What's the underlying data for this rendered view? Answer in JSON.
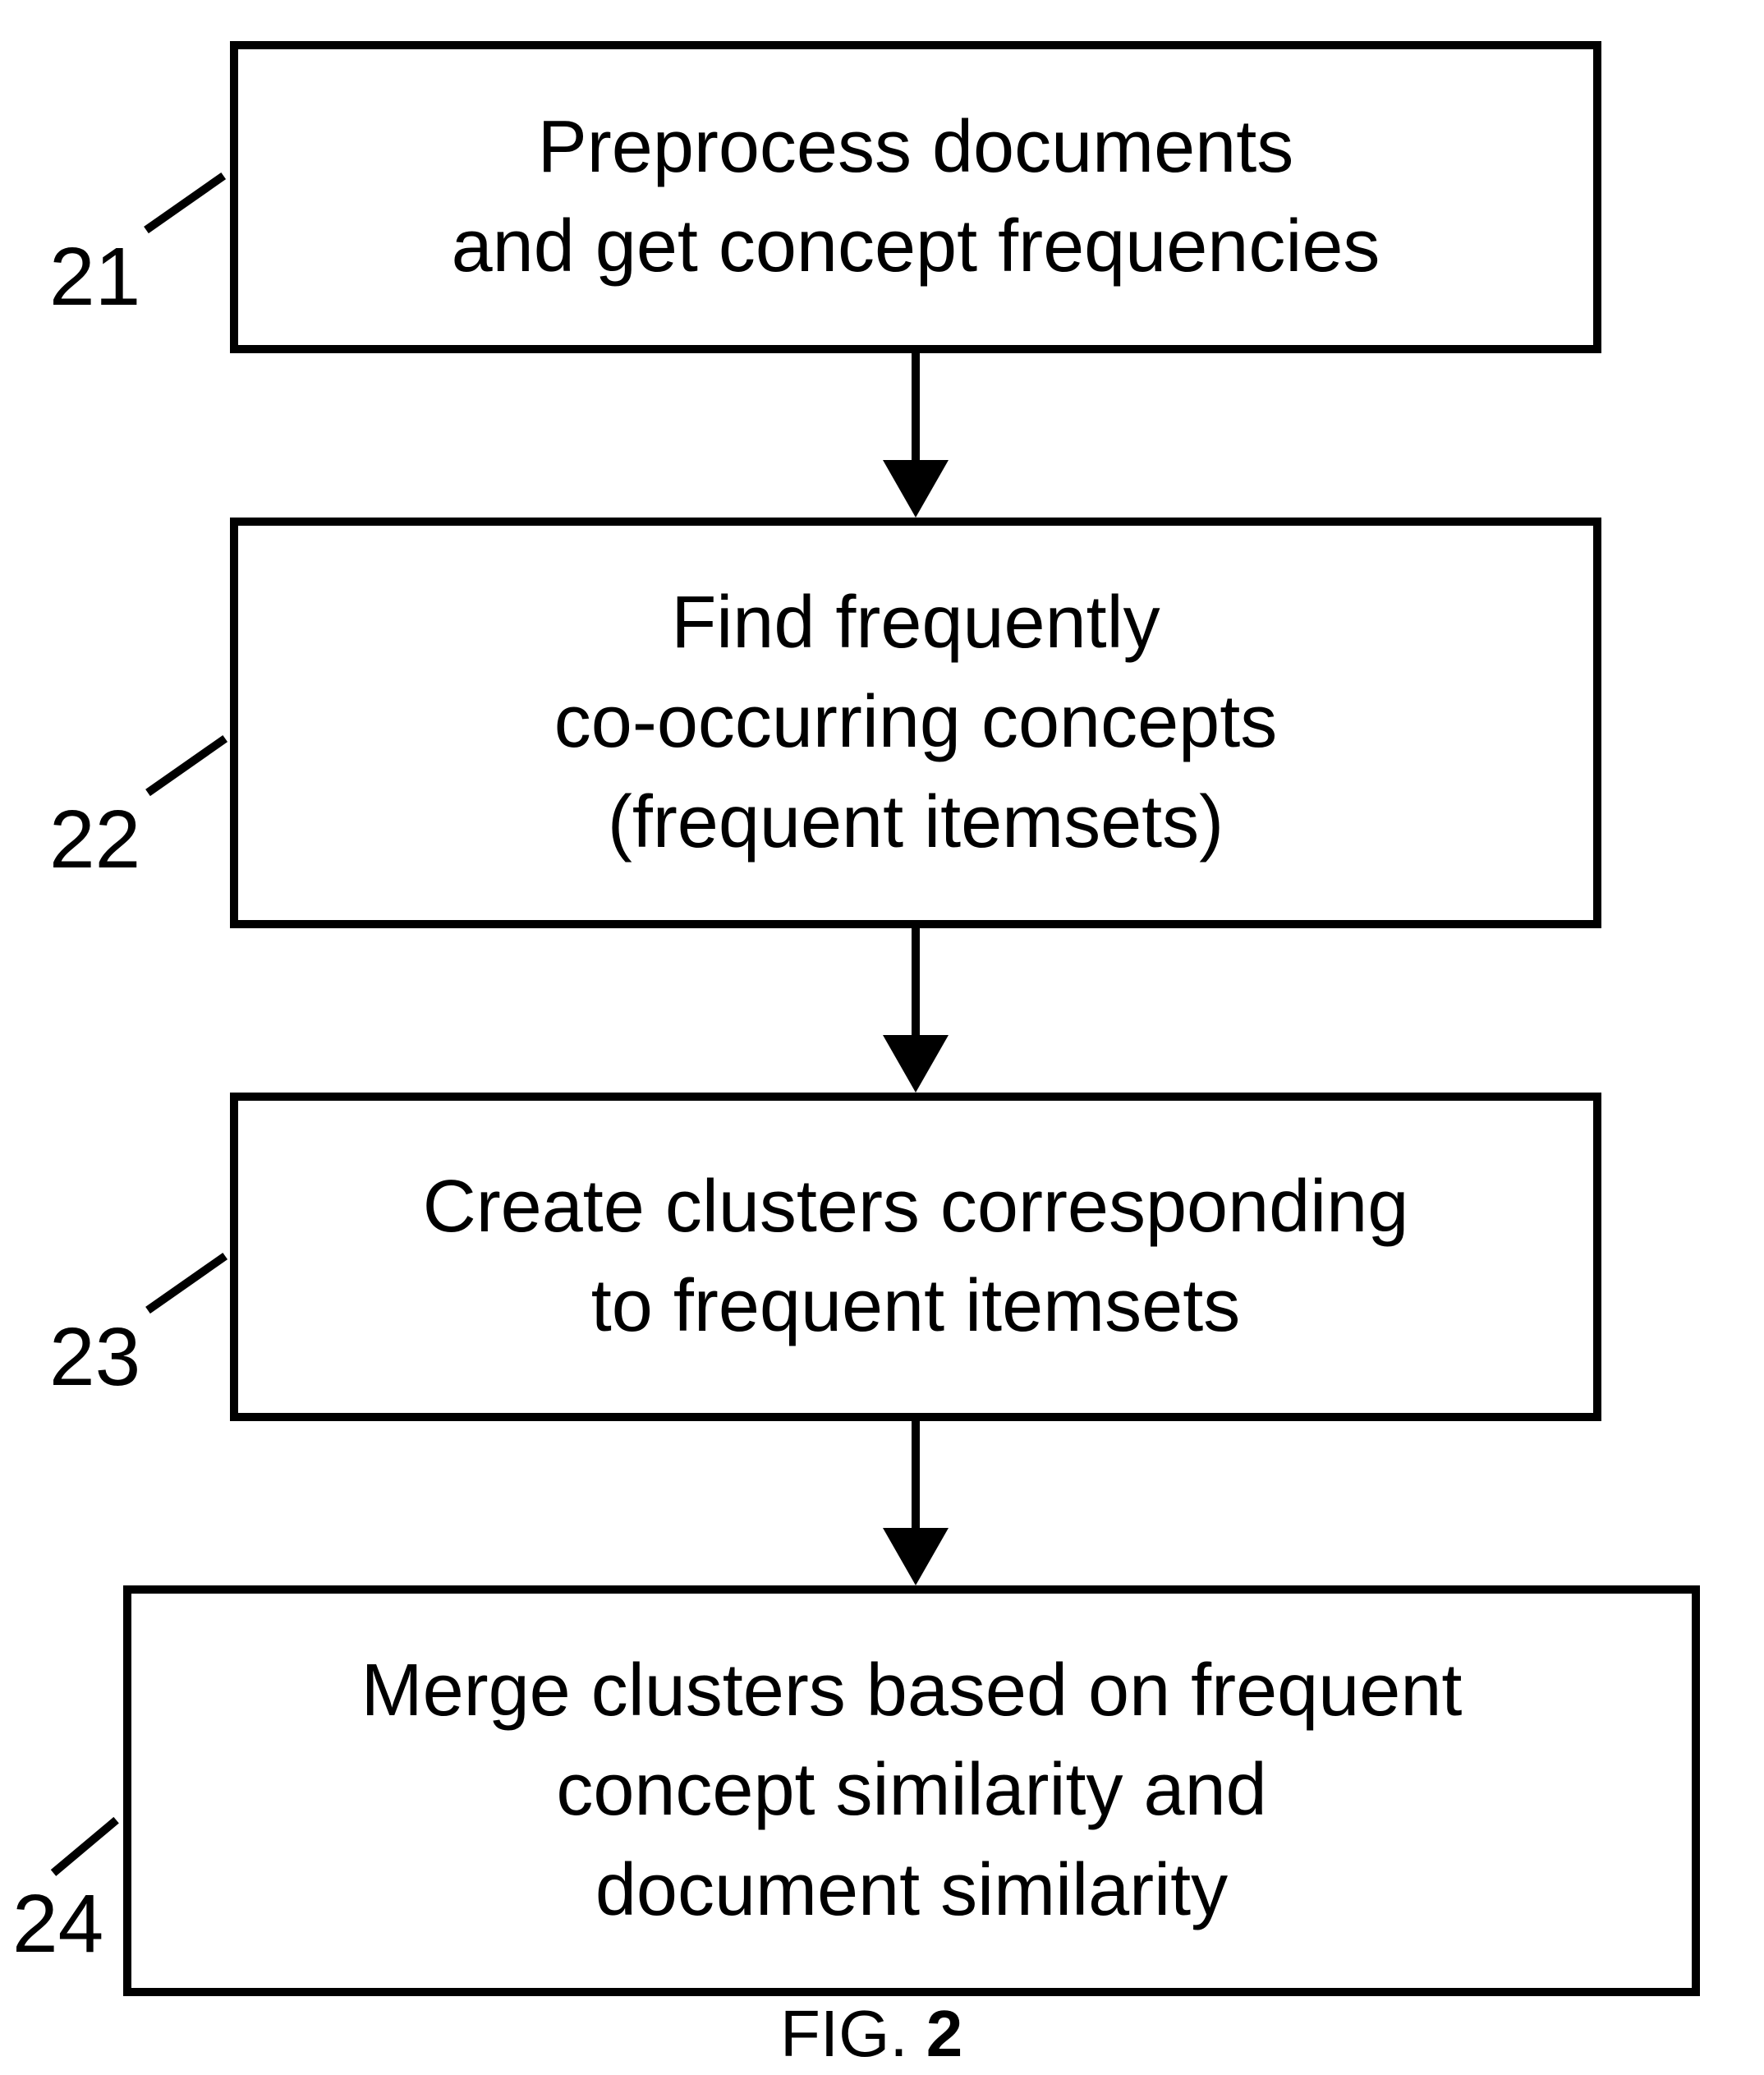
{
  "boxes": {
    "b1": {
      "label": "21",
      "line1": "Preprocess documents",
      "line2": "and get concept frequencies"
    },
    "b2": {
      "label": "22",
      "line1": "Find frequently",
      "line2": "co-occurring concepts",
      "line3": "(frequent itemsets)"
    },
    "b3": {
      "label": "23",
      "line1": "Create clusters corresponding",
      "line2": "to frequent itemsets"
    },
    "b4": {
      "label": "24",
      "line1": "Merge clusters based on frequent",
      "line2": "concept similarity and",
      "line3": "document similarity"
    }
  },
  "caption": {
    "prefix": "FIG. ",
    "number": "2"
  }
}
